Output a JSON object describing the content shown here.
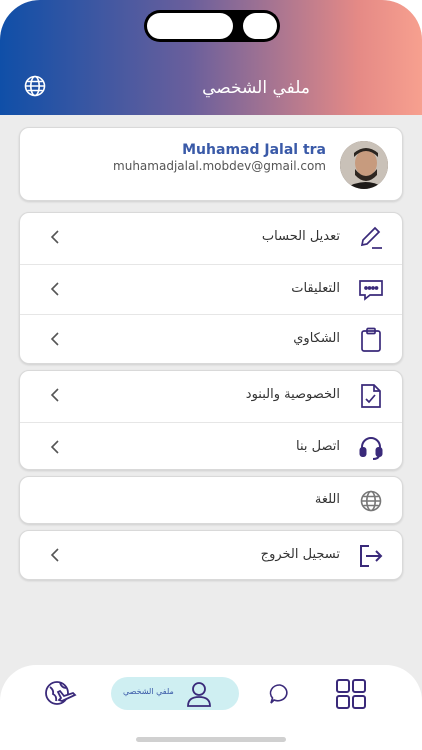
{
  "header": {
    "title": "ملفي الشخصي",
    "language_icon": "globe-icon"
  },
  "profile": {
    "name": "Muhamad Jalal tra",
    "email": "muhamadjalal.mobdev@gmail.com"
  },
  "menu_groups": [
    [
      {
        "label": "تعديل الحساب",
        "icon": "pencil-icon"
      },
      {
        "label": "التعليقات",
        "icon": "comment-dots-icon"
      },
      {
        "label": "الشكاوي",
        "icon": "clipboard-icon"
      }
    ],
    [
      {
        "label": "الخصوصية والبنود",
        "icon": "document-check-icon"
      },
      {
        "label": "اتصل بنا",
        "icon": "headset-icon"
      }
    ],
    [
      {
        "label": "اللغة",
        "icon": "globe-icon"
      }
    ],
    [
      {
        "label": "تسجيل الخروج",
        "icon": "logout-icon"
      }
    ]
  ],
  "bottom_nav": {
    "active_label": "ملفي الشخصي",
    "items": [
      "travel-globe-icon",
      "profile-icon",
      "chat-icon",
      "grid-icon"
    ]
  },
  "colors": {
    "accent": "#3a2a7a",
    "name_blue": "#3a5aa8",
    "active_pill": "#cfeff2"
  }
}
